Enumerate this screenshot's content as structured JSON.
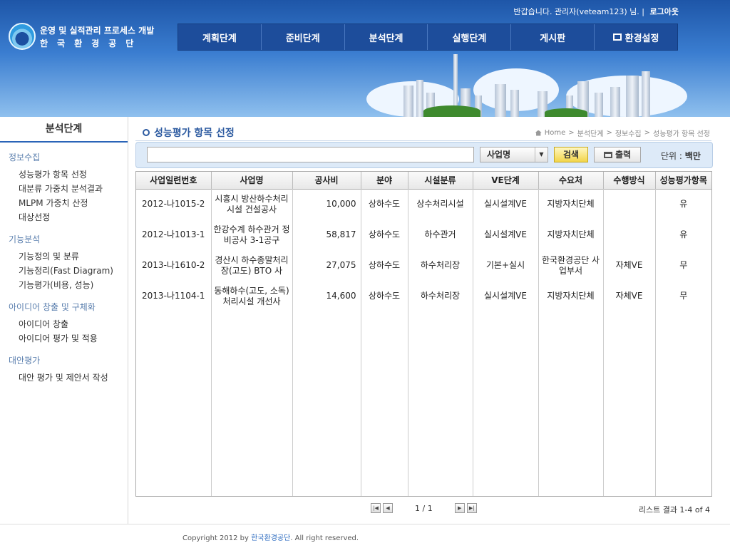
{
  "header": {
    "greeting": "반갑습니다. 관리자(veteam123) 님. |",
    "logout": "로그아웃",
    "logo_line1": "운영 및 실적관리 프로세스 개발",
    "logo_line2": "한국환경공단",
    "nav": [
      "계획단계",
      "준비단계",
      "분석단계",
      "실행단계",
      "게시판",
      "환경설정"
    ]
  },
  "sidebar": {
    "title": "분석단계",
    "groups": [
      {
        "label": "정보수집",
        "items": [
          "성능평가 항목 선정",
          "대분류 가중치 분석결과",
          "MLPM 가중치 산정",
          "대상선정"
        ]
      },
      {
        "label": "기능분석",
        "items": [
          "기능정의 및 분류",
          "기능정리(Fast Diagram)",
          "기능평가(비용, 성능)"
        ]
      },
      {
        "label": "아이디어 창출 및 구체화",
        "items": [
          "아이디어 창출",
          "아이디어 평가 및 적용"
        ]
      },
      {
        "label": "대안평가",
        "items": [
          "대안 평가 및 제안서 작성"
        ]
      }
    ]
  },
  "page": {
    "title": "성능평가 항목 선정",
    "breadcrumb": [
      "Home",
      "분석단계",
      "정보수집",
      "성능평가 항목 선정"
    ]
  },
  "search": {
    "value": "",
    "select_value": "사업명",
    "search_label": "검색",
    "print_label": "출력",
    "unit_label": "단위 :",
    "unit_value": "백만"
  },
  "table": {
    "columns": [
      "사업일련번호",
      "사업명",
      "공사비",
      "분야",
      "시설분류",
      "VE단계",
      "수요처",
      "수행방식",
      "성능평가항목"
    ],
    "rows": [
      [
        "2012-나1015-2",
        "시흥시 방산하수처리시설 건설공사",
        "10,000",
        "상하수도",
        "상수처리시설",
        "실시설계VE",
        "지방자치단체",
        "",
        "유"
      ],
      [
        "2012-나1013-1",
        "한강수계 하수관거 정비공사 3-1공구",
        "58,817",
        "상하수도",
        "하수관거",
        "실시설계VE",
        "지방자치단체",
        "",
        "유"
      ],
      [
        "2013-나1610-2",
        "경산시 하수종말처리장(고도) BTO 사",
        "27,075",
        "상하수도",
        "하수처리장",
        "기본+실시",
        "한국환경공단 사업부서",
        "자체VE",
        "무"
      ],
      [
        "2013-나1104-1",
        "동해하수(고도, 소독)처리시설 개선사",
        "14,600",
        "상하수도",
        "하수처리장",
        "실시설계VE",
        "지방자치단체",
        "자체VE",
        "무"
      ]
    ]
  },
  "pager": {
    "text": "1 / 1",
    "list_result": "리스트 결과 1-4 of 4"
  },
  "footer": {
    "copyright_prefix": "Copyright 2012 by",
    "org": "한국환경공단",
    "copyright_suffix": ". All right reserved."
  }
}
